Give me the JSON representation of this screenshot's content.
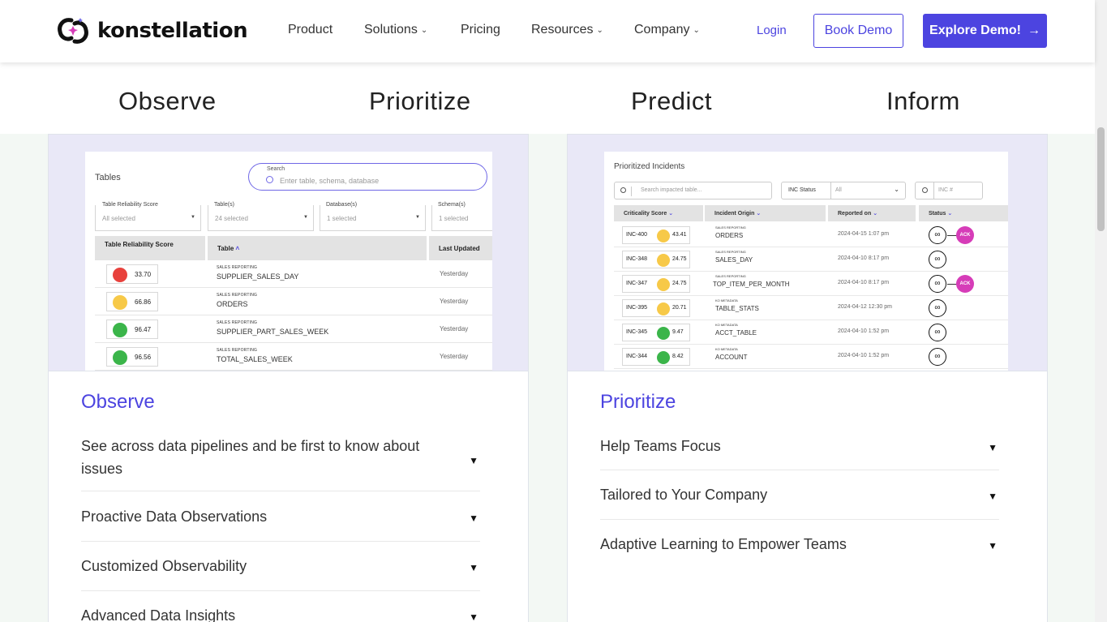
{
  "nav": {
    "brand": "konstellation",
    "items": [
      {
        "label": "Product",
        "has_dropdown": false
      },
      {
        "label": "Solutions",
        "has_dropdown": true
      },
      {
        "label": "Pricing",
        "has_dropdown": false
      },
      {
        "label": "Resources",
        "has_dropdown": true
      },
      {
        "label": "Company",
        "has_dropdown": true
      }
    ],
    "login": "Login",
    "book_demo": "Book Demo",
    "explore_demo": "Explore Demo!",
    "accent_color": "#4c44e0"
  },
  "tabs": [
    "Observe",
    "Prioritize",
    "Predict",
    "Inform"
  ],
  "observe_card": {
    "title": "Observe",
    "accordion": [
      "See across data pipelines and be first to know about issues",
      "Proactive Data Observations",
      "Customized Observability",
      "Advanced Data Insights"
    ],
    "screenshot": {
      "title": "Tables",
      "search_label": "Search",
      "search_placeholder": "Enter table, schema, database",
      "filters": [
        {
          "label": "Table Reliability Score",
          "value": "All selected"
        },
        {
          "label": "Table(s)",
          "value": "24 selected"
        },
        {
          "label": "Database(s)",
          "value": "1 selected"
        },
        {
          "label": "Schema(s)",
          "value": "1 selected"
        }
      ],
      "columns": [
        "Table Reliability Score",
        "Table",
        "Last Updated"
      ],
      "rows": [
        {
          "score": "33.70",
          "color": "#e8413c",
          "tags": "SALES     REPORTING",
          "table": "SUPPLIER_SALES_DAY",
          "updated": "Yesterday"
        },
        {
          "score": "66.86",
          "color": "#f7c948",
          "tags": "SALES     REPORTING",
          "table": "ORDERS",
          "updated": "Yesterday"
        },
        {
          "score": "96.47",
          "color": "#3bb54a",
          "tags": "SALES     REPORTING",
          "table": "SUPPLIER_PART_SALES_WEEK",
          "updated": "Yesterday"
        },
        {
          "score": "96.56",
          "color": "#3bb54a",
          "tags": "SALES     REPORTING",
          "table": "TOTAL_SALES_WEEK",
          "updated": "Yesterday"
        }
      ]
    }
  },
  "prioritize_card": {
    "title": "Prioritize",
    "accordion": [
      "Help Teams Focus",
      "Tailored to Your Company",
      "Adaptive Learning to Empower Teams"
    ],
    "screenshot": {
      "title": "Prioritized Incidents",
      "search_placeholder": "Search impacted table...",
      "status_label": "INC Status",
      "status_value": "All",
      "inc_placeholder": "INC #",
      "columns": [
        "Criticality Score",
        "Incident Origin",
        "Reported on",
        "Status"
      ],
      "rows": [
        {
          "id": "INC-400",
          "score": "43.41",
          "color": "#f7c948",
          "tags": "SALES     REPORTING",
          "origin": "ORDERS",
          "date": "2024-04-15 1:07 pm",
          "ack": true
        },
        {
          "id": "INC-348",
          "score": "24.75",
          "color": "#f7c948",
          "tags": "SALES     REPORTING",
          "origin": "SALES_DAY",
          "date": "2024-04-10 8:17 pm",
          "ack": false
        },
        {
          "id": "INC-347",
          "score": "24.75",
          "color": "#f7c948",
          "tags": "SALES     REPORTING",
          "origin": "TOP_ITEM_PER_MONTH",
          "date": "2024-04-10 8:17 pm",
          "ack": true
        },
        {
          "id": "INC-395",
          "score": "20.71",
          "color": "#f7c948",
          "tags": "KO     METADATA",
          "origin": "TABLE_STATS",
          "date": "2024-04-12 12:30 pm",
          "ack": false
        },
        {
          "id": "INC-345",
          "score": "9.47",
          "color": "#3bb54a",
          "tags": "KO     METADATA",
          "origin": "ACCT_TABLE",
          "date": "2024-04-10 1:52 pm",
          "ack": false
        },
        {
          "id": "INC-344",
          "score": "8.42",
          "color": "#3bb54a",
          "tags": "KO     METADATA",
          "origin": "ACCOUNT",
          "date": "2024-04-10 1:52 pm",
          "ack": false
        }
      ],
      "ack_label": "ACK"
    }
  }
}
